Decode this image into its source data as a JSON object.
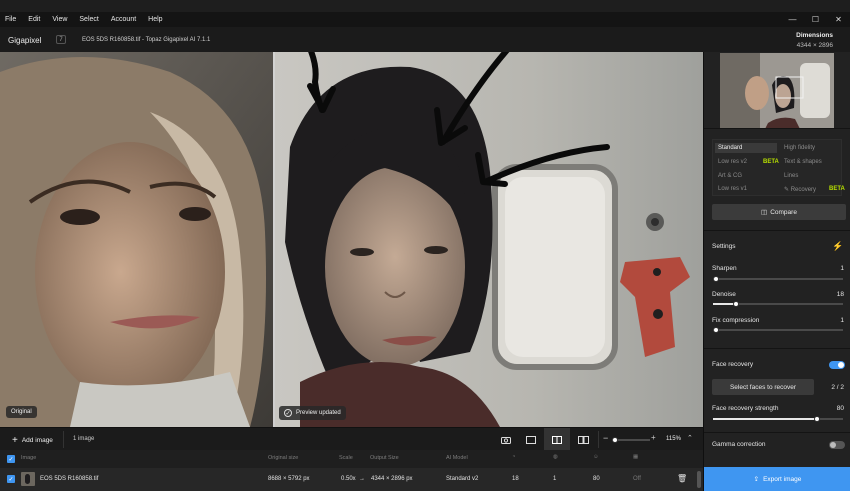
{
  "menu": {
    "items": [
      "File",
      "Edit",
      "View",
      "Select",
      "Account",
      "Help"
    ]
  },
  "window_controls": {
    "minimize": "—",
    "maximize": "☐",
    "close": "✕"
  },
  "header": {
    "app_name": "Gigapixel",
    "version_badge": "7",
    "document_title": "EOS 5DS R160858.tif - Topaz Gigapixel AI 7.1.1",
    "dimensions_label": "Dimensions",
    "dimensions_value": "4344 × 2896"
  },
  "preview": {
    "original_label": "Original",
    "preview_status": "Preview updated"
  },
  "sidebar": {
    "models": [
      {
        "label": "Standard",
        "selected": true
      },
      {
        "label": "High fidelity",
        "selected": false
      },
      {
        "label": "Low res v2",
        "selected": false
      },
      {
        "label": "Text & shapes",
        "selected": false
      },
      {
        "label": "Art & CG",
        "selected": false
      },
      {
        "label": "Lines",
        "selected": false
      },
      {
        "label": "Low res v1",
        "selected": false
      },
      {
        "label": "Recovery",
        "selected": false
      }
    ],
    "beta_label": "BETA",
    "compare_label": "Compare",
    "settings_title": "Settings",
    "sharpen": {
      "label": "Sharpen",
      "value": "1",
      "level": 0.01
    },
    "denoise": {
      "label": "Denoise",
      "value": "18",
      "level": 0.18
    },
    "fix_compression": {
      "label": "Fix compression",
      "value": "1",
      "level": 0.01
    },
    "face_recovery": {
      "label": "Face recovery",
      "enabled": true
    },
    "select_faces_label": "Select faces to recover",
    "faces_count": "2 / 2",
    "face_strength": {
      "label": "Face recovery strength",
      "value": "80",
      "level": 0.8
    },
    "gamma": {
      "label": "Gamma correction",
      "enabled": false
    },
    "export_label": "Export image"
  },
  "toolbar": {
    "add_image_label": "Add image",
    "image_count": "1 image",
    "zoom_value": "115%"
  },
  "table": {
    "headers": {
      "image": "Image",
      "original_size": "Original size",
      "scale": "Scale",
      "output_size": "Output Size",
      "ai_model": "AI Model"
    },
    "row": {
      "filename": "EOS 5DS R160858.tif",
      "original_size": "8688 × 5792 px",
      "scale": "0.50x",
      "arrow": "→",
      "output_size": "4344 × 2896 px",
      "ai_model": "Standard v2",
      "sharpen": "18",
      "denoise": "1",
      "face": "80",
      "gamma": "Off"
    }
  },
  "colors": {
    "accent": "#3f96f1",
    "beta": "#b8e000"
  }
}
